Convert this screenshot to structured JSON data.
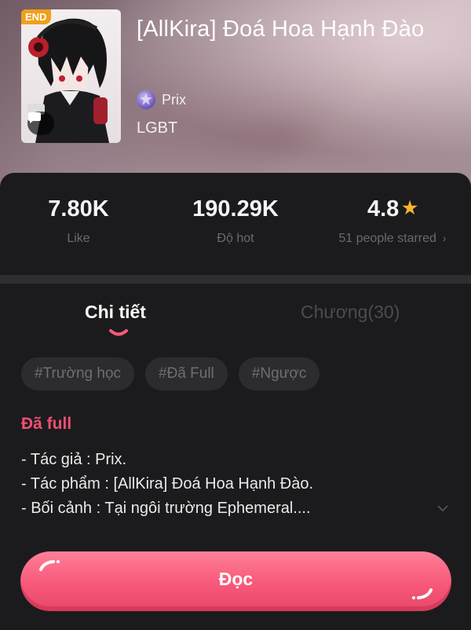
{
  "book": {
    "badge": "END",
    "title": "[AllKira] Đoá Hoa Hạnh Đào",
    "author": "Prix",
    "genre": "LGBT"
  },
  "stats": {
    "likes": {
      "value": "7.80K",
      "label": "Like"
    },
    "hot": {
      "value": "190.29K",
      "label": "Độ hot"
    },
    "rating": {
      "value": "4.8",
      "label": "51 people starred"
    }
  },
  "tabs": {
    "detail": "Chi tiết",
    "chapters": "Chương(30)",
    "active": "detail"
  },
  "tags": [
    "#Trường học",
    "#Đã Full",
    "#Ngược"
  ],
  "description": {
    "status": "Đã full",
    "lines": [
      "- Tác giả : Prix.",
      "- Tác phẩm : [AllKira] Đoá Hoa Hạnh Đào.",
      "- Bối cảnh : Tại ngôi trường Ephemeral...."
    ]
  },
  "actions": {
    "read": "Đọc"
  },
  "colors": {
    "accent": "#f8587a",
    "status": "#ef4f73",
    "star": "#f4b62a",
    "badge": "#f0a01c",
    "background": "#1b1b1d"
  },
  "icons": [
    "comment-icon",
    "author-avatar",
    "star-icon",
    "chevron-right-icon",
    "chevron-down-icon"
  ]
}
